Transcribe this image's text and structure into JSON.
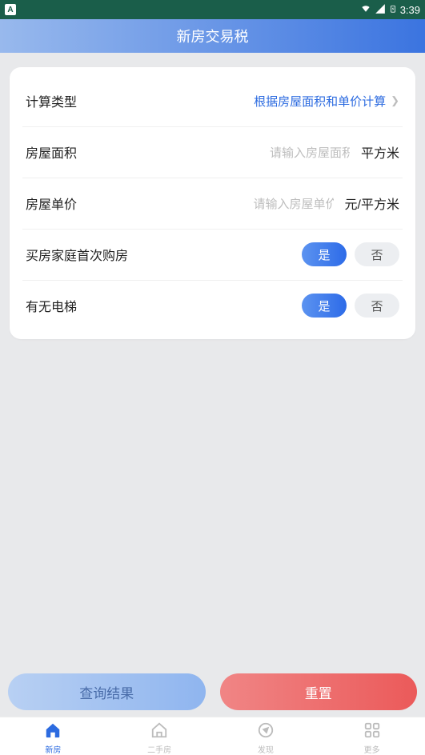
{
  "status": {
    "time": "3:39"
  },
  "header": {
    "title": "新房交易税"
  },
  "rows": {
    "calc_type": {
      "label": "计算类型",
      "value": "根据房屋面积和单价计算"
    },
    "area": {
      "label": "房屋面积",
      "placeholder": "请输入房屋面积",
      "unit": "平方米"
    },
    "price": {
      "label": "房屋单价",
      "placeholder": "请输入房屋单价",
      "unit": "元/平方米"
    },
    "first_buy": {
      "label": "买房家庭首次购房",
      "yes": "是",
      "no": "否"
    },
    "elevator": {
      "label": "有无电梯",
      "yes": "是",
      "no": "否"
    }
  },
  "buttons": {
    "query": "查询结果",
    "reset": "重置"
  },
  "nav": {
    "items": [
      {
        "label": "新房"
      },
      {
        "label": "二手房"
      },
      {
        "label": "发现"
      },
      {
        "label": "更多"
      }
    ]
  }
}
